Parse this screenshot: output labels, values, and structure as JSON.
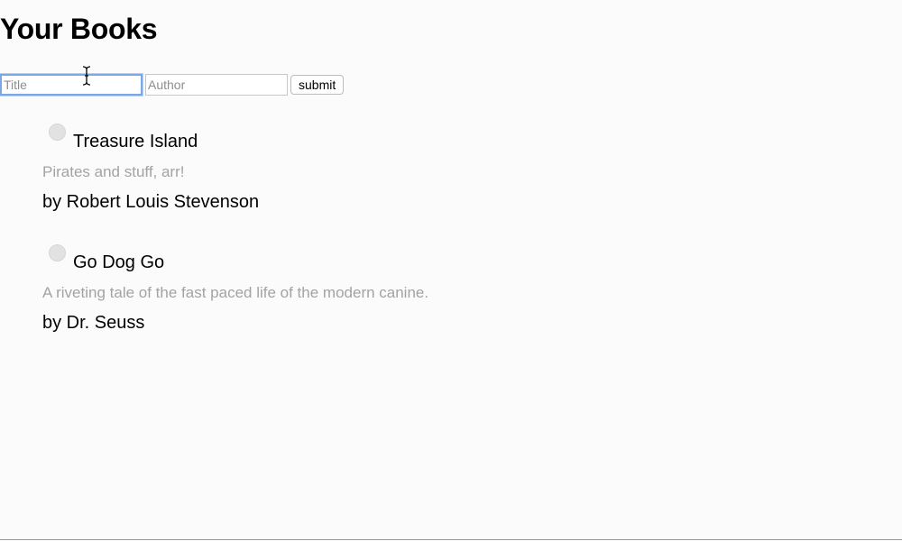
{
  "heading": "Your Books",
  "form": {
    "title_placeholder": "Title",
    "author_placeholder": "Author",
    "title_value": "",
    "author_value": "",
    "submit_label": "submit"
  },
  "books": [
    {
      "title": "Treasure Island",
      "description": "Pirates and stuff, arr!",
      "author": "by Robert Louis Stevenson"
    },
    {
      "title": "Go Dog Go",
      "description": "A riveting tale of the fast paced life of the modern canine.",
      "author": "by Dr. Seuss"
    }
  ],
  "colors": {
    "background": "#fbfbfb",
    "description_text": "#a3a3a3",
    "focus_ring": "#7aa7e6"
  }
}
